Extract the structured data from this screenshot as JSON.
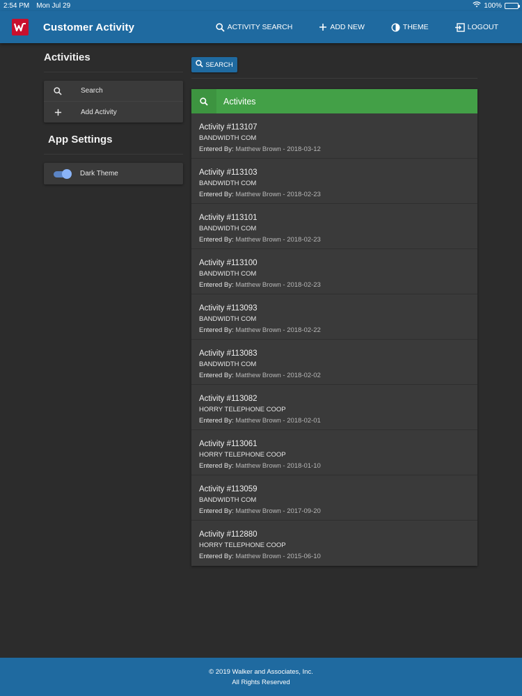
{
  "status_bar": {
    "time": "2:54 PM",
    "date": "Mon Jul 29",
    "battery": "100%"
  },
  "header": {
    "title": "Customer Activity",
    "nav": [
      {
        "label": "ACTIVITY SEARCH",
        "icon": "search-icon"
      },
      {
        "label": "ADD NEW",
        "icon": "plus-icon"
      },
      {
        "label": "THEME",
        "icon": "contrast-icon"
      },
      {
        "label": "LOGOUT",
        "icon": "logout-icon"
      }
    ]
  },
  "sidebar": {
    "activities_title": "Activities",
    "items": [
      {
        "label": "Search",
        "icon": "search-icon"
      },
      {
        "label": "Add Activity",
        "icon": "plus-icon"
      }
    ],
    "settings_title": "App Settings",
    "dark_theme_label": "Dark Theme",
    "dark_theme_on": true
  },
  "main": {
    "search_button": "SEARCH",
    "list_title": "Activites",
    "entered_by_label": "Entered By:",
    "activities": [
      {
        "title": "Activity #113107",
        "company": "BANDWIDTH COM",
        "entered_by": "Matthew Brown - 2018-03-12"
      },
      {
        "title": "Activity #113103",
        "company": "BANDWIDTH COM",
        "entered_by": "Matthew Brown - 2018-02-23"
      },
      {
        "title": "Activity #113101",
        "company": "BANDWIDTH COM",
        "entered_by": "Matthew Brown - 2018-02-23"
      },
      {
        "title": "Activity #113100",
        "company": "BANDWIDTH COM",
        "entered_by": "Matthew Brown - 2018-02-23"
      },
      {
        "title": "Activity #113093",
        "company": "BANDWIDTH COM",
        "entered_by": "Matthew Brown - 2018-02-22"
      },
      {
        "title": "Activity #113083",
        "company": "BANDWIDTH COM",
        "entered_by": "Matthew Brown - 2018-02-02"
      },
      {
        "title": "Activity #113082",
        "company": "HORRY TELEPHONE COOP",
        "entered_by": "Matthew Brown - 2018-02-01"
      },
      {
        "title": "Activity #113061",
        "company": "HORRY TELEPHONE COOP",
        "entered_by": "Matthew Brown - 2018-01-10"
      },
      {
        "title": "Activity #113059",
        "company": "BANDWIDTH COM",
        "entered_by": "Matthew Brown - 2017-09-20"
      },
      {
        "title": "Activity #112880",
        "company": "HORRY TELEPHONE COOP",
        "entered_by": "Matthew Brown - 2015-06-10"
      }
    ]
  },
  "footer": {
    "copyright": "© 2019 Walker and Associates, Inc.",
    "rights": "All Rights Reserved"
  },
  "colors": {
    "primary": "#1f6aa0",
    "header_green": "#43a047",
    "background": "#2c2c2c",
    "card": "#3a3a3a",
    "logo_red": "#c8102e",
    "toggle_blue": "#8ab4f8"
  }
}
